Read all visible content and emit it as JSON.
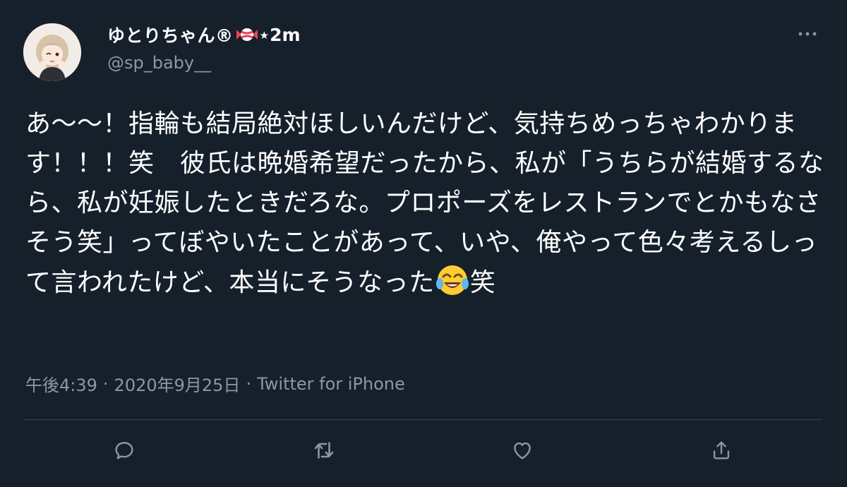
{
  "tweet": {
    "display_name": "ゆとりちゃん®",
    "name_suffix": "⋆2m",
    "handle": "@sp_baby__",
    "text_before_emoji": "あ〜〜！指輪も結局絶対ほしいんだけど、気持ちめっちゃわかります！！！笑　彼氏は晩婚希望だったから、私が「うちらが結婚するなら、私が妊娠したときだろな。プロポーズをレストランでとかもなさそう笑」ってぼやいたことがあって、いや、俺やって色々考えるしって言われたけど、本当にそうなった",
    "text_after_emoji": "笑",
    "emoji": "face-with-tears-of-joy",
    "time": "午後4:39",
    "date": "2020年9月25日",
    "source": "Twitter for iPhone",
    "separator": "·"
  },
  "icons": {
    "more": "more-horizontal-icon",
    "candy": "candy-icon",
    "reply": "reply-icon",
    "retweet": "retweet-icon",
    "like": "like-icon",
    "share": "share-icon"
  },
  "colors": {
    "background": "#15202b",
    "text": "#ffffff",
    "secondary_text": "#8899a6",
    "divider": "#38444d"
  }
}
